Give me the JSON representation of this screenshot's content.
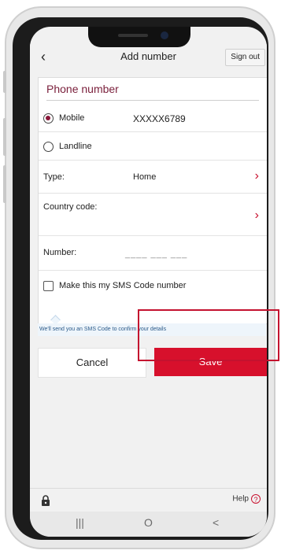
{
  "header": {
    "back_icon": "chevron-left-icon",
    "title": "Add number",
    "sign_out_label": "Sign out"
  },
  "form": {
    "section_title": "Phone number",
    "mobile_label": "Mobile",
    "mobile_value": "XXXXX6789",
    "landline_label": "Landline",
    "selected_option": "Mobile",
    "type_label": "Type:",
    "type_value": "Home",
    "country_code_label": "Country code:",
    "country_code_value": "",
    "number_label": "Number:",
    "number_placeholder": "____ ___ ___",
    "sms_checkbox_label": "Make this my SMS Code number",
    "sms_checkbox_checked": false,
    "sms_note": "We'll send you an SMS Code to confirm your details"
  },
  "actions": {
    "cancel_label": "Cancel",
    "save_label": "Save"
  },
  "footer": {
    "lock_icon": "lock-icon",
    "help_label": "Help",
    "help_icon": "help-circle-icon"
  },
  "nav": {
    "recents_icon": "|||",
    "home_icon": "O",
    "back_icon": "<"
  },
  "colors": {
    "brand_red": "#d7102c",
    "section_title": "#7a1f3b",
    "radio_selected": "#8a1538"
  }
}
